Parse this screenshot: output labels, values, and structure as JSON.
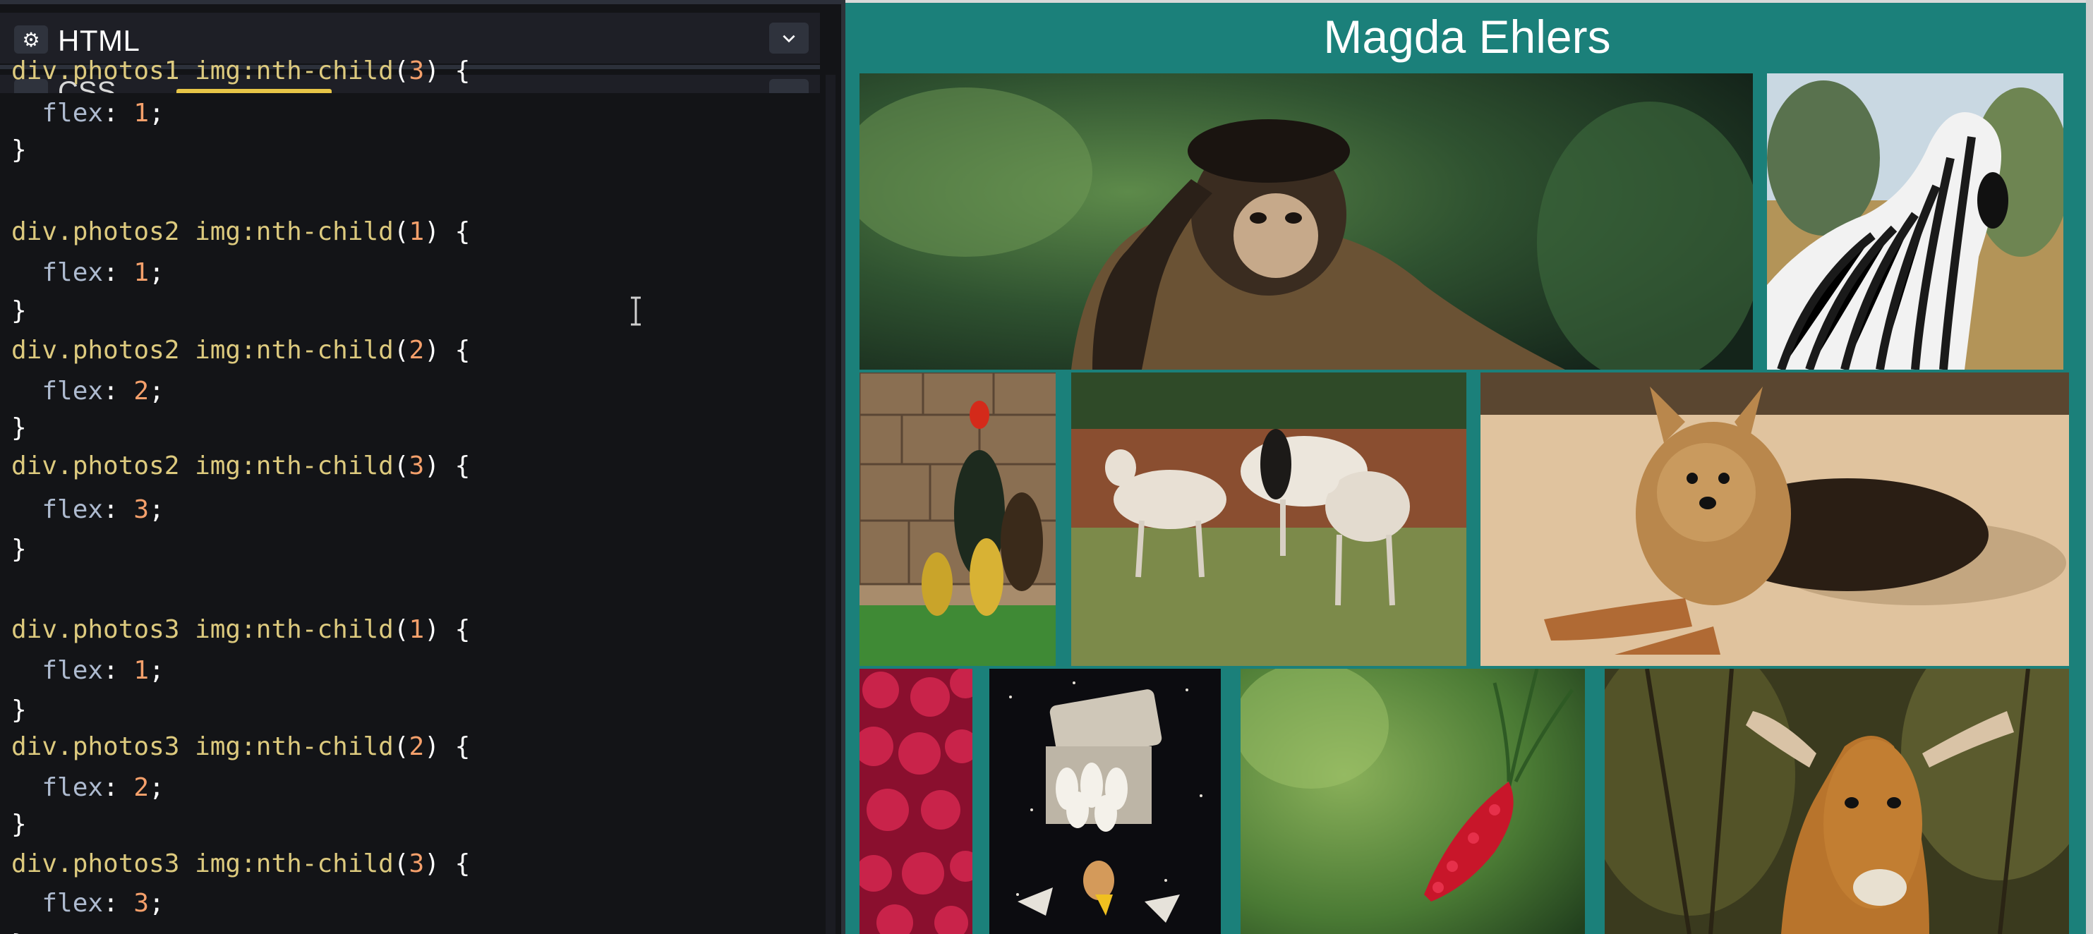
{
  "editor": {
    "html_panel": {
      "title": "HTML",
      "icon": "gear-icon",
      "toggle_icon": "chevron-down-icon"
    },
    "css_panel": {
      "title": "CSS",
      "icon": "gear-icon",
      "toggle_icon": "chevron-down-icon"
    },
    "code_lines": [
      "div.photos1 img:nth-child(3) {",
      "  flex: 1;",
      "}",
      "",
      "div.photos2 img:nth-child(1) {",
      "  flex: 1;",
      "}",
      "div.photos2 img:nth-child(2) {",
      "  flex: 2;",
      "}",
      "div.photos2 img:nth-child(3) {",
      "  flex: 3;",
      "}",
      "",
      "div.photos3 img:nth-child(1) {",
      "  flex: 1;",
      "}",
      "div.photos3 img:nth-child(2) {",
      "  flex: 2;",
      "}",
      "div.photos3 img:nth-child(3) {",
      "  flex: 3;",
      "}"
    ]
  },
  "preview": {
    "title": "Magda Ehlers",
    "photos": [
      {
        "name": "monkey"
      },
      {
        "name": "zebra"
      },
      {
        "name": "roosters"
      },
      {
        "name": "sheep"
      },
      {
        "name": "yorkshire-terrier"
      },
      {
        "name": "raspberries"
      },
      {
        "name": "eggs"
      },
      {
        "name": "bottlebrush-flower"
      },
      {
        "name": "impala"
      }
    ]
  },
  "colors": {
    "editor_bg": "#131417",
    "selector": "#ddca7e",
    "number": "#f5a06b",
    "property": "#aebbd0",
    "preview_bg": "#1b807a"
  }
}
